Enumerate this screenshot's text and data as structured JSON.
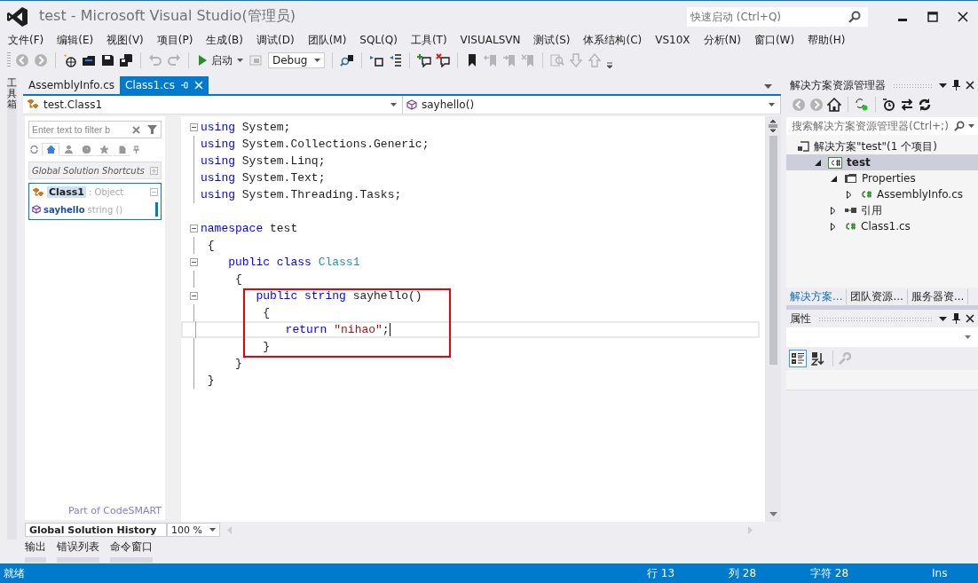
{
  "window": {
    "title": "test - Microsoft Visual Studio(管理员)",
    "quick_launch": {
      "placeholder": "快速启动 (Ctrl+Q)"
    }
  },
  "menu": [
    "文件(F)",
    "编辑(E)",
    "视图(V)",
    "项目(P)",
    "生成(B)",
    "调试(D)",
    "团队(M)",
    "SQL(Q)",
    "工具(T)",
    "VISUALSVN",
    "测试(S)",
    "体系结构(C)",
    "VS10X",
    "分析(N)",
    "窗口(W)",
    "帮助(H)"
  ],
  "toolbar": [
    {
      "kind": "back",
      "disabled": true
    },
    {
      "kind": "forward",
      "disabled": true
    },
    {
      "kind": "separator"
    },
    {
      "kind": "new-project",
      "disabled": false
    },
    {
      "kind": "open",
      "disabled": false
    },
    {
      "kind": "save",
      "disabled": false
    },
    {
      "kind": "save-all",
      "disabled": false
    },
    {
      "kind": "separator"
    },
    {
      "kind": "undo",
      "disabled": true
    },
    {
      "kind": "redo",
      "disabled": true
    },
    {
      "kind": "separator"
    },
    {
      "kind": "start",
      "label": "启动"
    },
    {
      "kind": "attach",
      "disabled": true
    },
    {
      "kind": "config",
      "value": "Debug"
    },
    {
      "kind": "separator"
    },
    {
      "kind": "find-symbol",
      "disabled": false
    },
    {
      "kind": "separator"
    },
    {
      "kind": "indent",
      "disabled": false
    },
    {
      "kind": "outdent",
      "disabled": false
    },
    {
      "kind": "separator"
    },
    {
      "kind": "comment",
      "disabled": false
    },
    {
      "kind": "uncomment",
      "disabled": false
    },
    {
      "kind": "separator"
    },
    {
      "kind": "bookmark",
      "disabled": false
    },
    {
      "kind": "prev-bookmark",
      "disabled": true
    },
    {
      "kind": "next-bookmark",
      "disabled": true
    },
    {
      "kind": "clear-bookmarks",
      "disabled": true
    },
    {
      "kind": "separator"
    },
    {
      "kind": "find-results",
      "disabled": true
    },
    {
      "kind": "down",
      "disabled": true
    },
    {
      "kind": "up",
      "disabled": true
    }
  ],
  "toolbox_strip": "工具箱",
  "editor": {
    "tabs": [
      {
        "label": "AssemblyInfo.cs",
        "selected": false
      },
      {
        "label": "Class1.cs",
        "selected": true
      }
    ],
    "type_dropdown": "test.Class1",
    "member_dropdown": "sayhello()",
    "codesmart": {
      "filter": {
        "placeholder": "Enter text to filter b"
      },
      "tabs": [
        {
          "kind": "home",
          "selected": true
        },
        {
          "kind": "person",
          "selected": false
        },
        {
          "kind": "clock",
          "selected": false
        },
        {
          "kind": "star",
          "selected": false
        },
        {
          "kind": "doc",
          "selected": false
        }
      ],
      "shortcuts": "Global Solution Shortcuts",
      "class": {
        "name": "Class1",
        "base": ": Object",
        "member": "sayhello",
        "signature": "string ()"
      },
      "link": "Part of CodeSMART",
      "history": "Global Solution History"
    },
    "zoom": "100 %",
    "lines": [
      {
        "collapsible": true,
        "boxed": false,
        "current": false,
        "tokens": [
          {
            "kind": "keyword",
            "t": "using"
          },
          {
            "kind": "plain",
            "t": " System;"
          }
        ]
      },
      {
        "collapsible": false,
        "boxed": false,
        "current": false,
        "tokens": [
          {
            "kind": "keyword",
            "t": "using"
          },
          {
            "kind": "plain",
            "t": " System.Collections.Generic;"
          }
        ]
      },
      {
        "collapsible": false,
        "boxed": false,
        "current": false,
        "tokens": [
          {
            "kind": "keyword",
            "t": "using"
          },
          {
            "kind": "plain",
            "t": " System.Linq;"
          }
        ]
      },
      {
        "collapsible": false,
        "boxed": false,
        "current": false,
        "tokens": [
          {
            "kind": "keyword",
            "t": "using"
          },
          {
            "kind": "plain",
            "t": " System.Text;"
          }
        ]
      },
      {
        "collapsible": false,
        "boxed": false,
        "current": false,
        "tokens": [
          {
            "kind": "keyword",
            "t": "using"
          },
          {
            "kind": "plain",
            "t": " System.Threading.Tasks;"
          }
        ]
      },
      {
        "collapsible": false,
        "boxed": false,
        "current": false
      },
      {
        "collapsible": true,
        "boxed": false,
        "current": false,
        "tokens": [
          {
            "kind": "keyword",
            "t": "namespace"
          },
          {
            "kind": "plain",
            "t": " test"
          }
        ]
      },
      {
        "collapsible": false,
        "boxed": false,
        "current": false,
        "tokens": [
          {
            "kind": "plain",
            "t": " {"
          }
        ]
      },
      {
        "collapsible": true,
        "boxed": false,
        "current": false,
        "tokens": [
          {
            "kind": "keyword",
            "t": "    public class "
          },
          {
            "kind": "type",
            "t": "Class1"
          }
        ]
      },
      {
        "collapsible": false,
        "boxed": false,
        "current": false,
        "tokens": [
          {
            "kind": "plain",
            "t": "     {"
          }
        ]
      },
      {
        "collapsible": true,
        "boxed": true,
        "current": false,
        "tokens": [
          {
            "kind": "keyword",
            "t": "        public string"
          },
          {
            "kind": "plain",
            "t": " sayhello()"
          }
        ]
      },
      {
        "collapsible": false,
        "boxed": true,
        "current": false,
        "tokens": [
          {
            "kind": "plain",
            "t": "         {"
          }
        ]
      },
      {
        "collapsible": false,
        "boxed": true,
        "current": true,
        "tokens": [
          {
            "kind": "keyword",
            "t": "            return "
          },
          {
            "kind": "string",
            "t": "\"nihao\""
          },
          {
            "kind": "plain",
            "t": ";"
          }
        ]
      },
      {
        "collapsible": false,
        "boxed": true,
        "current": false,
        "tokens": [
          {
            "kind": "plain",
            "t": "         }"
          }
        ]
      },
      {
        "collapsible": false,
        "boxed": false,
        "current": false,
        "tokens": [
          {
            "kind": "plain",
            "t": "     }"
          }
        ]
      },
      {
        "collapsible": false,
        "boxed": false,
        "current": false,
        "tokens": [
          {
            "kind": "plain",
            "t": " }"
          }
        ]
      }
    ]
  },
  "solution_explorer": {
    "title": "解决方案资源管理器",
    "toolbar": [
      {
        "kind": "back",
        "disabled": true
      },
      {
        "kind": "forward",
        "disabled": true
      },
      {
        "kind": "home",
        "disabled": false
      },
      {
        "kind": "separator"
      },
      {
        "kind": "sync",
        "disabled": false
      },
      {
        "kind": "separator"
      },
      {
        "kind": "pending",
        "disabled": false
      },
      {
        "kind": "switch",
        "disabled": false
      },
      {
        "kind": "refresh",
        "disabled": false
      }
    ],
    "search": {
      "placeholder": "搜索解决方案资源管理器(Ctrl+;)"
    },
    "tree": [
      {
        "kind": "solution",
        "label": "解决方案\"test\"(1 个项目)",
        "selected": false,
        "children": [
          {
            "kind": "project",
            "label": "test",
            "expanded": true,
            "selected": true,
            "children": [
              {
                "kind": "folder",
                "label": "Properties",
                "expanded": true,
                "selected": false,
                "children": [
                  {
                    "kind": "cs",
                    "label": "AssemblyInfo.cs",
                    "expanded": false,
                    "selected": false
                  }
                ]
              },
              {
                "kind": "references",
                "label": "引用",
                "expanded": false,
                "selected": false
              },
              {
                "kind": "cs",
                "label": "Class1.cs",
                "expanded": false,
                "selected": false
              }
            ]
          }
        ]
      }
    ],
    "tabs": [
      {
        "label": "解决方案...",
        "selected": true
      },
      {
        "label": "团队资源...",
        "selected": false
      },
      {
        "label": "服务器资...",
        "selected": false
      }
    ]
  },
  "properties": {
    "title": "属性",
    "toolbar": [
      {
        "kind": "categorized",
        "selected": true
      },
      {
        "kind": "alphabetical",
        "selected": false
      }
    ]
  },
  "bottom_tabs": [
    "输出",
    "错误列表",
    "命令窗口"
  ],
  "status_bar": {
    "message": "就绪",
    "line": "行 13",
    "column": "列 28",
    "char": "字符 28",
    "mode": "Ins"
  }
}
